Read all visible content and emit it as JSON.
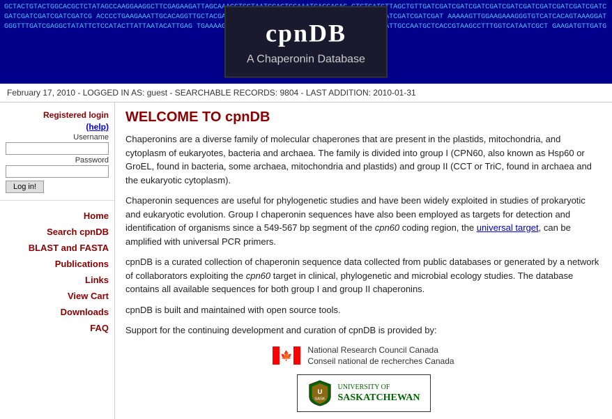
{
  "header": {
    "dna_sequence": "GCTACTGTACTGGCACGCTCTATAGCCAAGGAAGGCTTCGAGAAGATTAGCAAAGGTGCTAATCCAGTGGAAATCAGGAGAG GTGTGATGTTAGCTGTTGATC ACCCCTGAAGAAATTGCACA GGTTGCTACGATTTCTGCAA AAAAAGTTGGAAGAAAGGGT GTCATCACAGTAAAGGATGG GTTTGATCGAGGCTATATT CTCCATACTTATTAATACA TTGAGTGAAAAGAAAATTTC TAGTATCCGTCCATTGTACCTGCTCTTGAAATTGCCAATGCTCACCGTAAGCCTTTGGTCATAATCGCTGAAGATGTTGATG",
    "site_name": "cpnDB",
    "site_subtitle": "A Chaperonin Database"
  },
  "info_bar": {
    "text": "February 17, 2010 - LOGGED IN AS: guest - SEARCHABLE RECORDS: 9804 - LAST ADDITION: 2010-01-31"
  },
  "sidebar": {
    "login_label": "Registered login",
    "login_help": "(help)",
    "username_label": "Username",
    "password_label": "Password",
    "login_button": "Log in!",
    "nav_items": [
      {
        "label": "Home",
        "href": "#"
      },
      {
        "label": "Search cpnDB",
        "href": "#"
      },
      {
        "label": "BLAST and FASTA",
        "href": "#"
      },
      {
        "label": "Publications",
        "href": "#"
      },
      {
        "label": "Links",
        "href": "#"
      },
      {
        "label": "View Cart",
        "href": "#"
      },
      {
        "label": "Downloads",
        "href": "#"
      },
      {
        "label": "FAQ",
        "href": "#"
      }
    ]
  },
  "content": {
    "title": "WELCOME TO cpnDB",
    "paragraphs": [
      "Chaperonins are a diverse family of molecular chaperones that are present in the plastids, mitochondria, and cytoplasm of eukaryotes, bacteria and archaea. The family is divided into group I (CPN60, also known as Hsp60 or GroEL, found in bacteria, some archaea, mitochondria and plastids) and group II (CCT or TriC, found in archaea and the eukaryotic cytoplasm).",
      "Chaperonin sequences are useful for phylogenetic studies and have been widely exploited in studies of prokaryotic and eukaryotic evolution. Group I chaperonin sequences have also been employed as targets for detection and identification of organisms since a 549-567 bp segment of the cpn60 coding region, the \"universal target\", can be amplified with universal PCR primers.",
      "cpnDB is a curated collection of chaperonin sequence data collected from public databases or generated by a network of collaborators exploiting the cpn60 target in clinical, phylogenetic and microbial ecology studies. The database contains all available sequences for both group I and group II chaperonins.",
      "cpnDB is built and maintained with open source tools.",
      "Support for the continuing development and curation of cpnDB is provided by:"
    ],
    "universal_target_link": "universal target",
    "nrc": {
      "name_en": "National Research Council Canada",
      "name_fr": "Conseil national de recherches Canada"
    },
    "usask": {
      "line1": "University of",
      "line2": "Saskatchewan"
    }
  }
}
